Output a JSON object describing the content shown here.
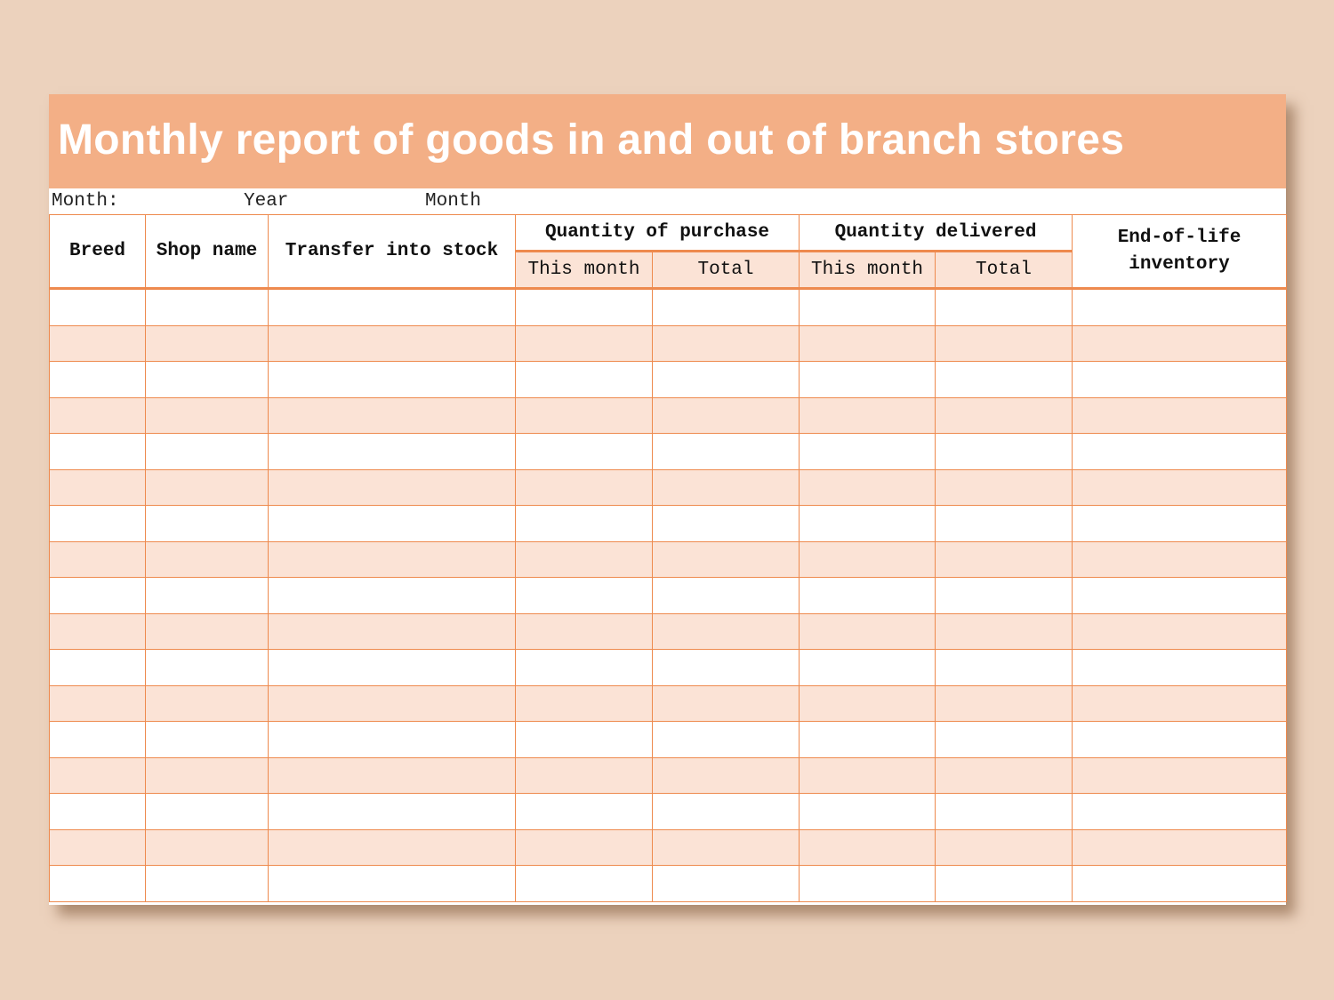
{
  "title": "Monthly report of goods in and out of branch stores",
  "meta": {
    "month_label": "Month:",
    "year_label": "Year",
    "month_unit": "Month"
  },
  "columns": {
    "breed": "Breed",
    "shop_name": "Shop name",
    "transfer_into_stock": "Transfer into stock",
    "quantity_of_purchase": "Quantity of purchase",
    "quantity_delivered": "Quantity delivered",
    "end_of_life_inventory": "End-of-life inventory",
    "purchase_this_month": "This month",
    "purchase_total": "Total",
    "delivered_this_month": "This month",
    "delivered_total": "Total"
  },
  "rows": [
    [
      "",
      "",
      "",
      "",
      "",
      "",
      "",
      ""
    ],
    [
      "",
      "",
      "",
      "",
      "",
      "",
      "",
      ""
    ],
    [
      "",
      "",
      "",
      "",
      "",
      "",
      "",
      ""
    ],
    [
      "",
      "",
      "",
      "",
      "",
      "",
      "",
      ""
    ],
    [
      "",
      "",
      "",
      "",
      "",
      "",
      "",
      ""
    ],
    [
      "",
      "",
      "",
      "",
      "",
      "",
      "",
      ""
    ],
    [
      "",
      "",
      "",
      "",
      "",
      "",
      "",
      ""
    ],
    [
      "",
      "",
      "",
      "",
      "",
      "",
      "",
      ""
    ],
    [
      "",
      "",
      "",
      "",
      "",
      "",
      "",
      ""
    ],
    [
      "",
      "",
      "",
      "",
      "",
      "",
      "",
      ""
    ],
    [
      "",
      "",
      "",
      "",
      "",
      "",
      "",
      ""
    ],
    [
      "",
      "",
      "",
      "",
      "",
      "",
      "",
      ""
    ],
    [
      "",
      "",
      "",
      "",
      "",
      "",
      "",
      ""
    ],
    [
      "",
      "",
      "",
      "",
      "",
      "",
      "",
      ""
    ],
    [
      "",
      "",
      "",
      "",
      "",
      "",
      "",
      ""
    ],
    [
      "",
      "",
      "",
      "",
      "",
      "",
      "",
      ""
    ],
    [
      "",
      "",
      "",
      "",
      "",
      "",
      "",
      ""
    ]
  ],
  "colors": {
    "banner": "#f3af86",
    "border": "#ee8a4e",
    "alt_row": "#fbe3d6",
    "background": "#ecd2bd"
  }
}
